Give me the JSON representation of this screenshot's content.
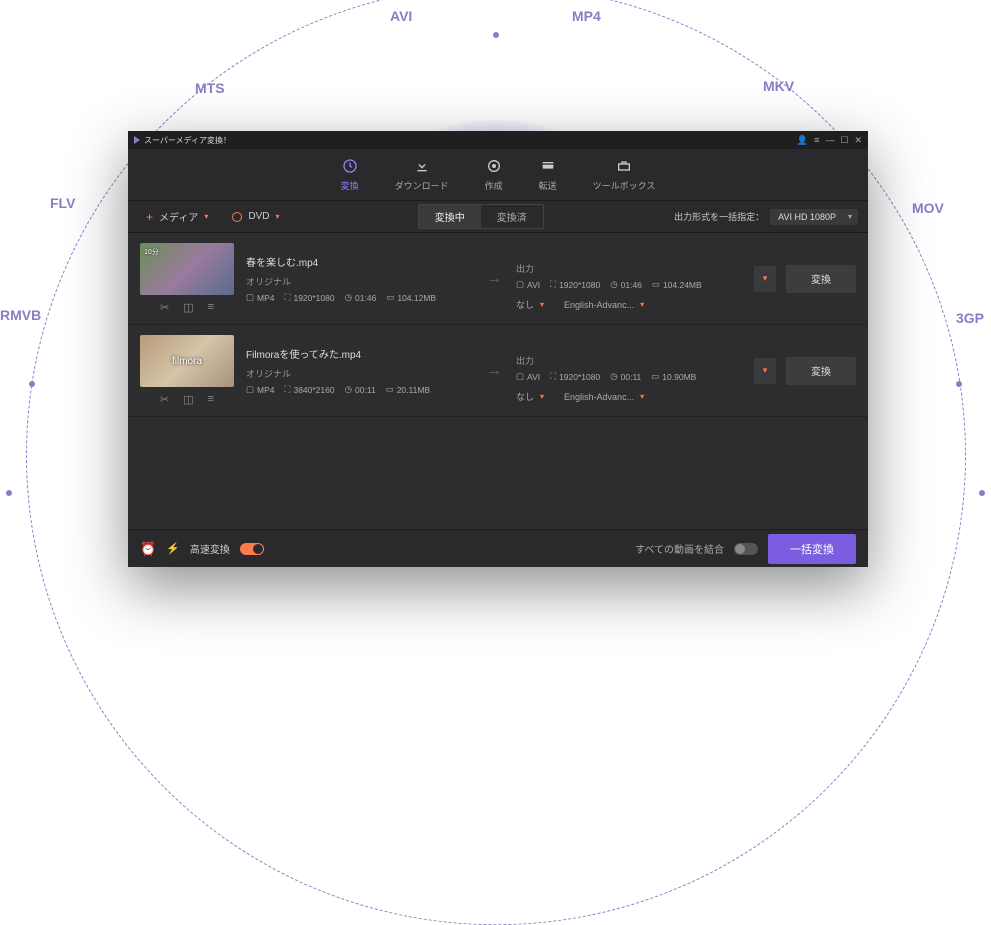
{
  "orbit": {
    "labels": [
      "AVI",
      "MP4",
      "MTS",
      "MKV",
      "FLV",
      "MOV",
      "RMVB",
      "3GP"
    ]
  },
  "titlebar": {
    "app_name": "スーパーメディア変換！"
  },
  "nav": {
    "items": [
      {
        "label": "変換"
      },
      {
        "label": "ダウンロード"
      },
      {
        "label": "作成"
      },
      {
        "label": "転送"
      },
      {
        "label": "ツールボックス"
      }
    ]
  },
  "toolbar": {
    "media_label": "メディア",
    "dvd_label": "DVD",
    "tab_converting": "変換中",
    "tab_converted": "変換済",
    "output_label": "出力形式を一括指定：",
    "output_value": "AVI HD 1080P"
  },
  "rows": [
    {
      "thumb_time": "10分",
      "filename": "春を楽しむ.mp4",
      "orig_label": "オリジナル",
      "orig_fmt": "MP4",
      "orig_res": "1920*1080",
      "orig_dur": "01:46",
      "orig_size": "104.12MB",
      "out_label": "出力",
      "out_fmt": "AVI",
      "out_res": "1920*1080",
      "out_dur": "01:46",
      "out_size": "104.24MB",
      "sub_none": "なし",
      "sub_lang": "English-Advanc...",
      "convert": "変換"
    },
    {
      "thumb_wm": "filmora",
      "filename": "Filmoraを使ってみた.mp4",
      "orig_label": "オリジナル",
      "orig_fmt": "MP4",
      "orig_res": "3840*2160",
      "orig_dur": "00:11",
      "orig_size": "20.11MB",
      "out_label": "出力",
      "out_fmt": "AVI",
      "out_res": "1920*1080",
      "out_dur": "00:11",
      "out_size": "10.90MB",
      "sub_none": "なし",
      "sub_lang": "English-Advanc...",
      "convert": "変換"
    }
  ],
  "footer": {
    "speed_label": "高速変換",
    "merge_label": "すべての動画を結合",
    "batch_label": "一括変換"
  }
}
